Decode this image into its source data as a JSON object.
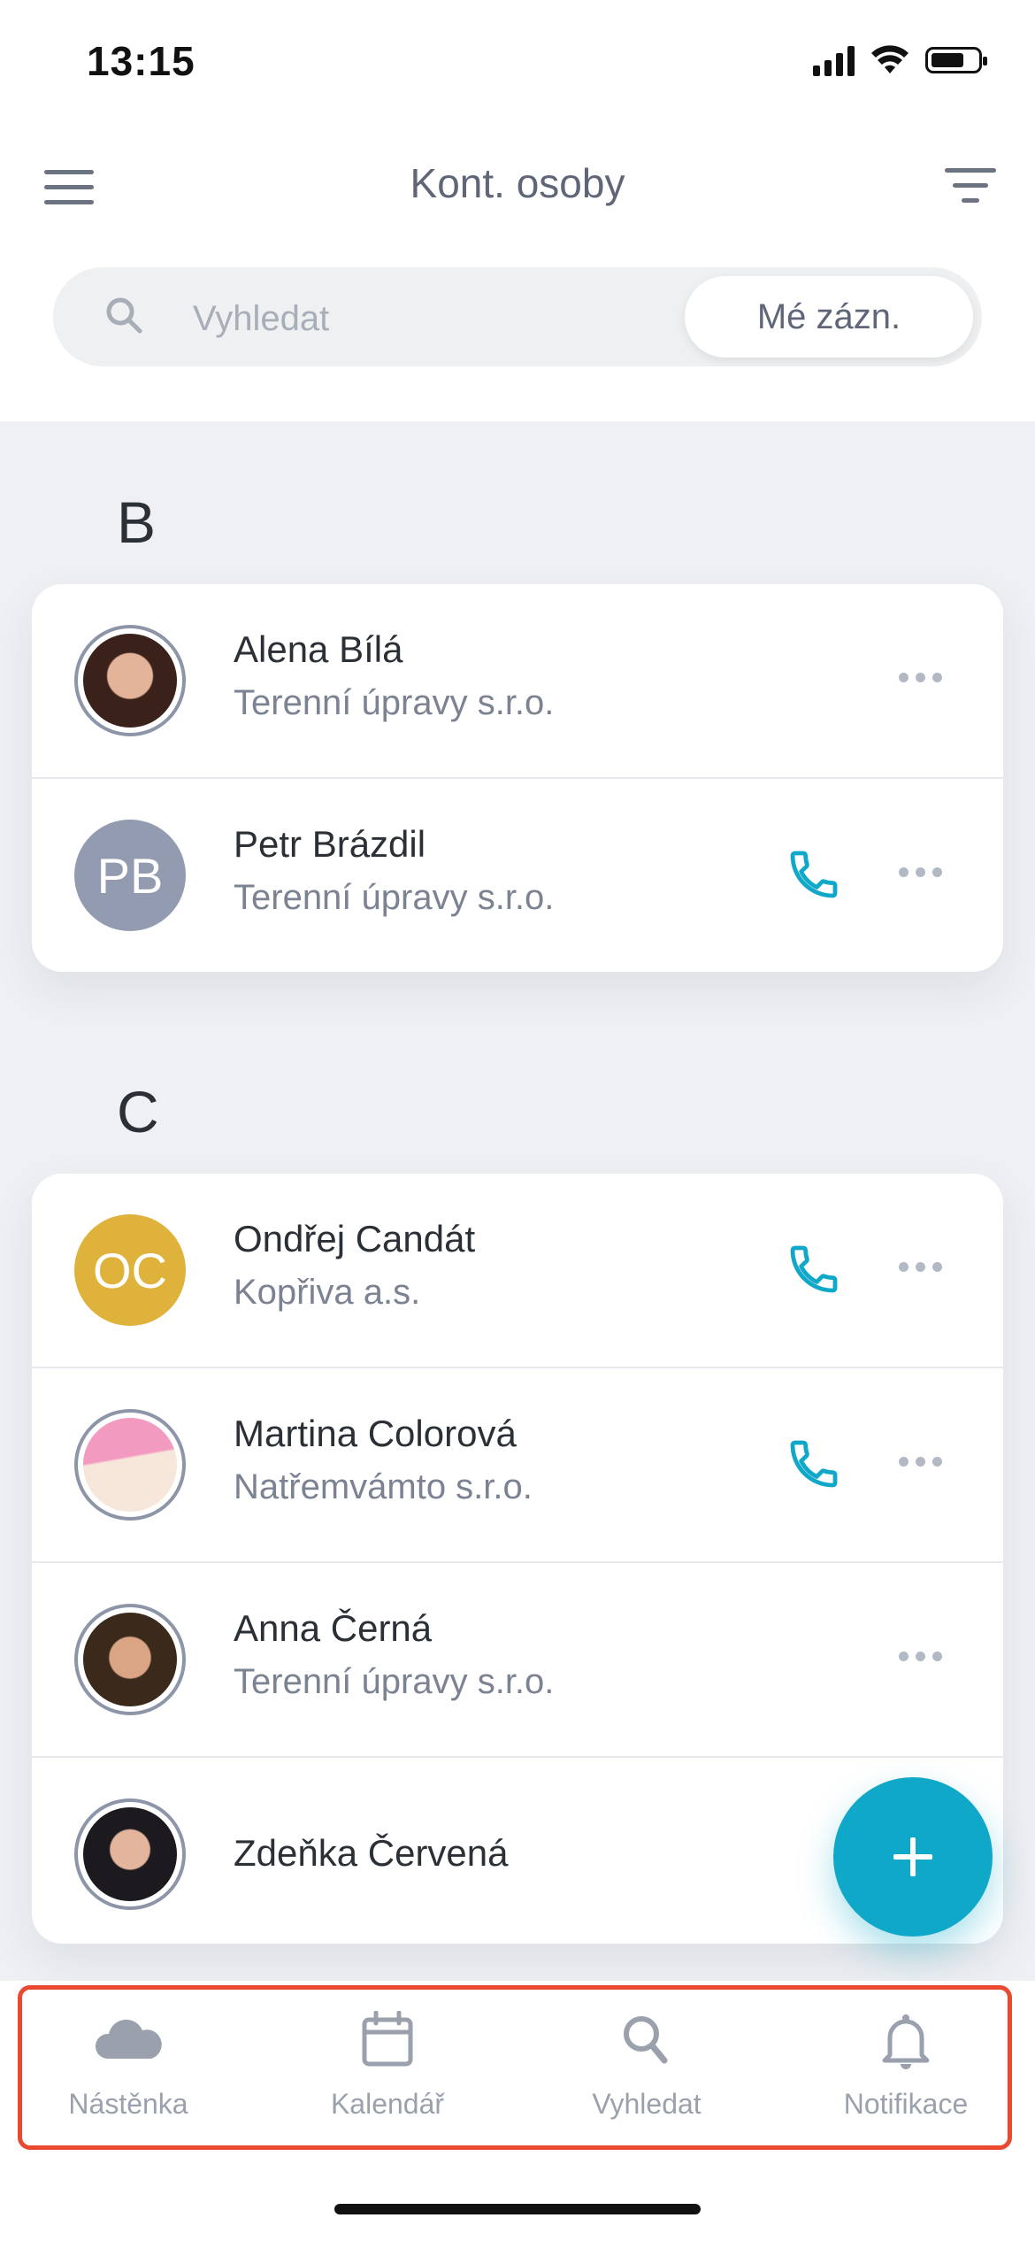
{
  "status_bar": {
    "time": "13:15"
  },
  "header": {
    "title": "Kont. osoby"
  },
  "search": {
    "placeholder": "Vyhledat",
    "my_records_label": "Mé zázn."
  },
  "sections": [
    {
      "letter": "B",
      "contacts": [
        {
          "name": "Alena Bílá",
          "company": "Terenní úpravy s.r.o.",
          "avatar": "photo",
          "has_phone": false
        },
        {
          "name": "Petr Brázdil",
          "company": "Terenní úpravy s.r.o.",
          "avatar": "initials",
          "initials": "PB",
          "avatar_color": "#939bb0",
          "has_phone": true
        }
      ]
    },
    {
      "letter": "C",
      "contacts": [
        {
          "name": "Ondřej Candát",
          "company": "Kopřiva a.s.",
          "avatar": "initials",
          "initials": "OC",
          "avatar_color": "#dfb23c",
          "has_phone": true
        },
        {
          "name": "Martina Colorová",
          "company": "Natřemvámto s.r.o.",
          "avatar": "photo",
          "has_phone": true
        },
        {
          "name": "Anna Černá",
          "company": "Terenní úpravy s.r.o.",
          "avatar": "photo",
          "has_phone": false
        },
        {
          "name": "Zdeňka Červená",
          "company": "",
          "avatar": "photo",
          "has_phone": false
        }
      ]
    }
  ],
  "tabbar": {
    "items": [
      {
        "label": "Nástěnka",
        "icon": "cloud-icon"
      },
      {
        "label": "Kalendář",
        "icon": "calendar-icon"
      },
      {
        "label": "Vyhledat",
        "icon": "search-icon"
      },
      {
        "label": "Notifikace",
        "icon": "bell-icon"
      }
    ]
  },
  "colors": {
    "accent": "#10a8c8",
    "highlight": "#e8492f"
  }
}
